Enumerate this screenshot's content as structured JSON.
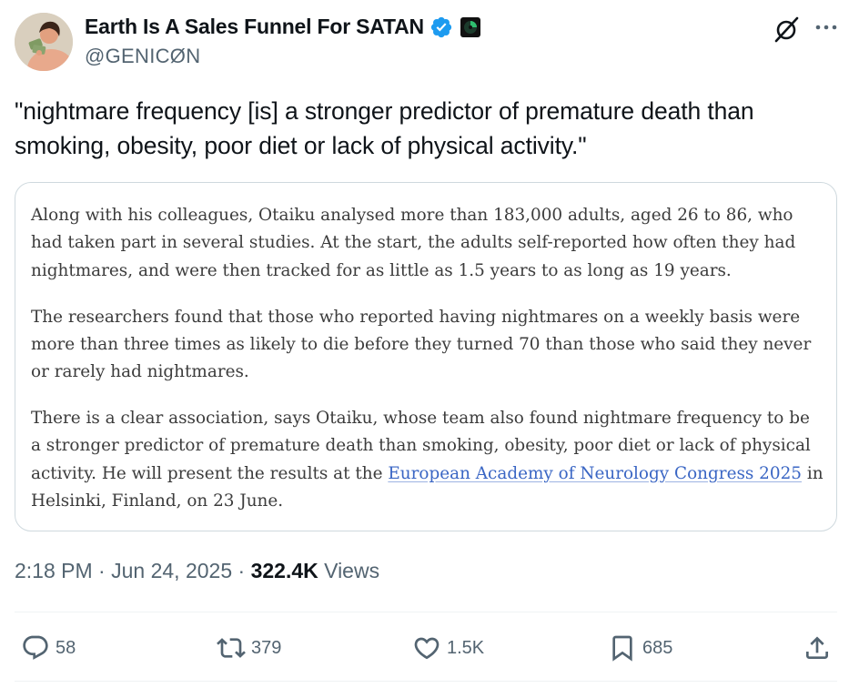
{
  "author": {
    "display_name": "Earth Is A Sales Funnel For SATAN",
    "handle": "@GENICØN",
    "avatar_icon": "profile-photo",
    "verified_icon": "verified-badge-icon",
    "badge_icon": "cd-emoji-icon"
  },
  "tweet": {
    "text": "\"nightmare frequency [is] a stronger predictor of premature death than smoking, obesity, poor diet or lack of physical activity.\""
  },
  "quote_card": {
    "p1": "Along with his colleagues, Otaiku analysed more than 183,000 adults, aged 26 to 86, who had taken part in several studies. At the start, the adults self-reported how often they had nightmares, and were then tracked for as little as 1.5 years to as long as 19 years.",
    "p2": "The researchers found that those who reported having nightmares on a weekly basis were more than three times as likely to die before they turned 70 than those who said they never or rarely had nightmares.",
    "p3_before": "There is a clear association, says Otaiku, whose team also found nightmare frequency to be a stronger predictor of premature death than smoking, obesity, poor diet or lack of physical activity. He will present the results at the ",
    "p3_link": "European Academy of Neurology Congress 2025",
    "p3_after": " in Helsinki, Finland, on 23 June."
  },
  "meta": {
    "time": "2:18 PM",
    "sep1": " · ",
    "date": "Jun 24, 2025",
    "sep2": " · ",
    "views_count": "322.4K",
    "views_label": " Views"
  },
  "actions": {
    "replies": "58",
    "reposts": "379",
    "likes": "1.5K",
    "bookmarks": "685"
  },
  "colors": {
    "text": "#0f1419",
    "secondary": "#536471",
    "verified": "#1d9bf0",
    "link": "#3a66c4",
    "border": "#cfd9de"
  }
}
